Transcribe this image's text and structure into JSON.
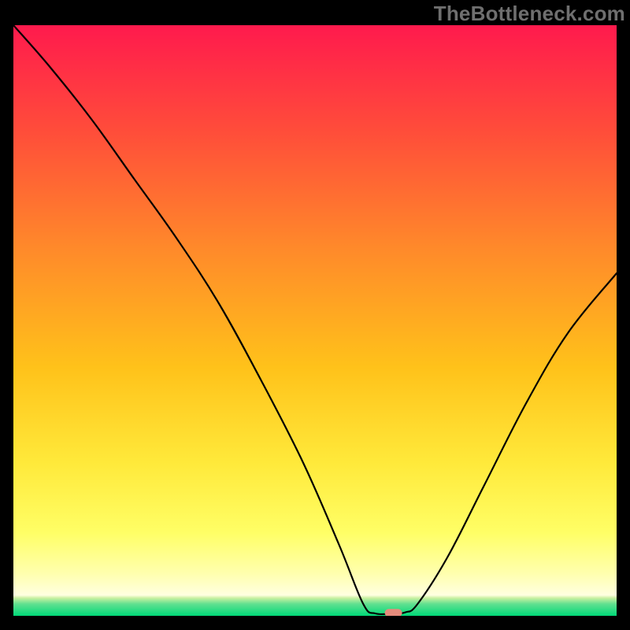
{
  "watermark": "TheBottleneck.com",
  "chart_data": {
    "type": "line",
    "title": "",
    "xlabel": "",
    "ylabel": "",
    "xlim": [
      0,
      100
    ],
    "ylim": [
      0,
      100
    ],
    "background_gradient": {
      "top": "#ff1a4d",
      "upper": "#ff8a2a",
      "middle": "#ffd400",
      "lower": "#ffff66",
      "near_bottom": "#ffff9e",
      "bottom_band": "#00d978"
    },
    "marker": {
      "x": 63,
      "y": 0.5,
      "color": "#e58b7c"
    },
    "curve": [
      {
        "x": 0,
        "y": 100
      },
      {
        "x": 6,
        "y": 93
      },
      {
        "x": 13,
        "y": 84
      },
      {
        "x": 20,
        "y": 74
      },
      {
        "x": 27,
        "y": 64
      },
      {
        "x": 34,
        "y": 53
      },
      {
        "x": 41,
        "y": 40
      },
      {
        "x": 48,
        "y": 26
      },
      {
        "x": 54,
        "y": 12
      },
      {
        "x": 58,
        "y": 2
      },
      {
        "x": 60,
        "y": 0.4
      },
      {
        "x": 63,
        "y": 0.4
      },
      {
        "x": 65,
        "y": 0.6
      },
      {
        "x": 67,
        "y": 2
      },
      {
        "x": 72,
        "y": 10
      },
      {
        "x": 78,
        "y": 22
      },
      {
        "x": 85,
        "y": 36
      },
      {
        "x": 92,
        "y": 48
      },
      {
        "x": 100,
        "y": 58
      }
    ]
  }
}
